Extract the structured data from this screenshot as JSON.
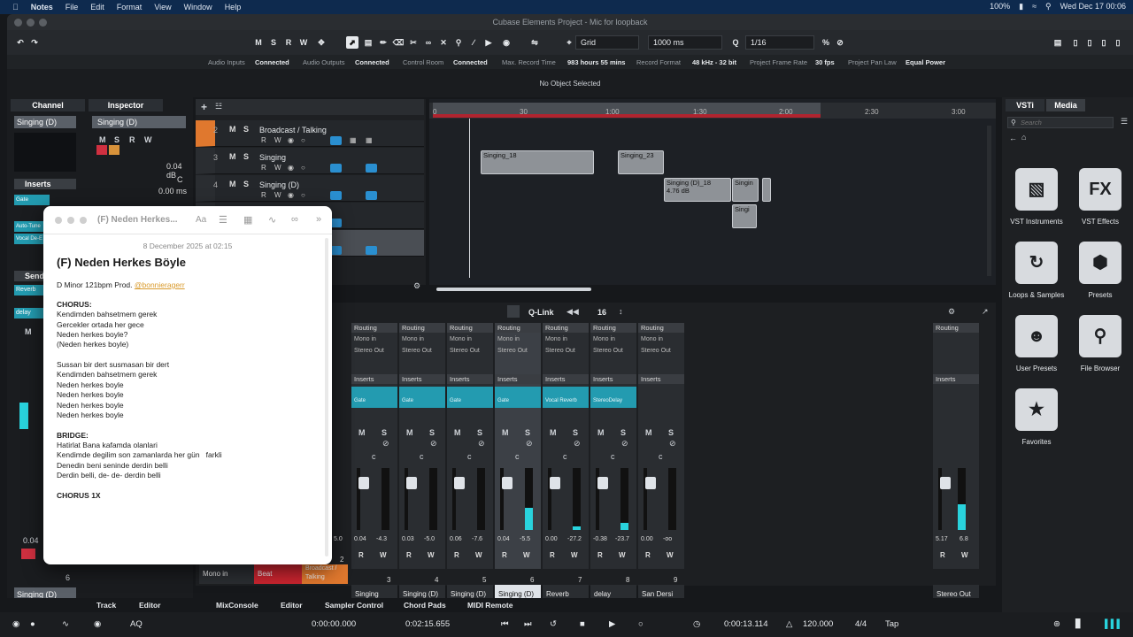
{
  "menubar": {
    "app": "Notes",
    "items": [
      "File",
      "Edit",
      "Format",
      "View",
      "Window",
      "Help"
    ],
    "battery": "100%",
    "clock": "Wed Dec 17  00:06"
  },
  "window": {
    "title": "Cubase Elements Project - Mic for loopback"
  },
  "toolbar": {
    "mode_buttons": [
      "M",
      "S",
      "R",
      "W"
    ],
    "snap": "Grid",
    "snap_value": "1000 ms",
    "quantize": "1/16"
  },
  "status": {
    "audio_inputs": "Audio Inputs",
    "audio_inputs_v": "Connected",
    "audio_outputs": "Audio Outputs",
    "audio_outputs_v": "Connected",
    "control_room": "Control Room",
    "control_room_v": "Connected",
    "max_rec": "Max. Record Time",
    "max_rec_v": "983 hours 55 mins",
    "rec_fmt": "Record Format",
    "rec_fmt_v": "48 kHz - 32 bit",
    "frame_rate": "Project Frame Rate",
    "frame_rate_v": "30 fps",
    "pan_law": "Project Pan Law",
    "pan_law_v": "Equal Power"
  },
  "info": {
    "text": "No Object Selected"
  },
  "left": {
    "tab_channel": "Channel",
    "tab_inspector": "Inspector",
    "channel_name": "Singing (D)",
    "inspector_name": "Singing (D)",
    "inserts": "Inserts",
    "sends": "Sends",
    "gate": "Gate",
    "auto_tune": "Auto-Tune",
    "vocal": "Vocal De-E",
    "reverb": "Reverb",
    "delay": "delay",
    "vol": "0.04 dB",
    "pan": "C",
    "delay_ms": "0.00 ms",
    "fader_val": "0.04",
    "ch_num": "6",
    "m_btn": "M"
  },
  "tracks": [
    {
      "num": "2",
      "name": "Broadcast / Talking"
    },
    {
      "num": "3",
      "name": "Singing"
    },
    {
      "num": "4",
      "name": "Singing (D)"
    },
    {
      "num": "",
      "name": ""
    },
    {
      "num": "",
      "name": ""
    }
  ],
  "ruler": {
    "ticks": [
      "0",
      "30",
      "1:00",
      "1:30",
      "2:00",
      "2:30",
      "3:00"
    ]
  },
  "clips": {
    "c1": "Singing_18",
    "c2": "Singing_23",
    "c3": "Singing (D)_18",
    "c3b": "4.76 dB",
    "c4": "Singin",
    "c5": "Singi"
  },
  "mixer": {
    "qlink": "Q-Link",
    "visible": "16",
    "routing": "Routing",
    "mono_in": "Mono in",
    "stereo_out": "Stereo Out",
    "inserts": "Inserts",
    "strips": [
      {
        "plug": "Gate",
        "db1": "0.04",
        "db2": "-4.3",
        "num": "3",
        "name": "Singing",
        "fill": 0.0
      },
      {
        "plug": "Gate",
        "db1": "0.03",
        "db2": "-5.0",
        "num": "4",
        "name": "Singing (D)",
        "fill": 0.0
      },
      {
        "plug": "Gate",
        "db1": "0.06",
        "db2": "-7.6",
        "num": "5",
        "name": "Singing (D)",
        "fill": 0.0
      },
      {
        "plug": "Gate",
        "db1": "0.04",
        "db2": "-5.5",
        "num": "6",
        "name": "Singing (D)",
        "fill": 0.35
      },
      {
        "plug": "Vocal Reverb",
        "db1": "0.00",
        "db2": "-27.2",
        "num": "7",
        "name": "Reverb",
        "fill": 0.05
      },
      {
        "plug": "StereoDelay",
        "db1": "-0.38",
        "db2": "-23.7",
        "num": "8",
        "name": "delay",
        "fill": 0.12
      },
      {
        "plug": "",
        "db1": "0.00",
        "db2": "-oo",
        "num": "9",
        "name": "San Dersi",
        "fill": 0.0
      }
    ],
    "left_names": [
      "Mono in",
      "Beat",
      "Broadcast / Talking"
    ],
    "first_db": "5.0",
    "first_num": "2",
    "master": {
      "routing": "Routing",
      "inserts": "Inserts",
      "db1": "5.17",
      "db2": "6.8",
      "name": "Stereo Out",
      "fill": 0.42
    }
  },
  "bottom_tabs": {
    "track": "Track",
    "editor": "Editor",
    "mixconsole": "MixConsole",
    "editor2": "Editor",
    "sampler": "Sampler Control",
    "chord": "Chord Pads",
    "midi": "MIDI Remote"
  },
  "transport": {
    "aq": "AQ",
    "left_locator": "0:00:00.000",
    "right_locator": "0:02:15.655",
    "position": "0:00:13.114",
    "tempo": "120.000",
    "signature": "4/4",
    "tap": "Tap"
  },
  "right": {
    "tab_vsti": "VSTi",
    "tab_media": "Media",
    "search_placeholder": "Search",
    "tiles": [
      "VST Instruments",
      "VST Effects",
      "Loops & Samples",
      "Presets",
      "User Presets",
      "File Browser",
      "Favorites"
    ]
  },
  "notes": {
    "toolbar_title": "(F) Neden Herkes...",
    "date": "8 December 2025 at 02:15",
    "title": "(F) Neden Herkes Böyle",
    "meta": "D Minor 121bpm Prod. ",
    "handle": "@bonnieragerr",
    "lines": [
      "CHORUS:",
      "Kendimden bahsetmem gerek",
      "Gercekler ortada her gece",
      "Neden herkes boyle?",
      "(Neden herkes boyle)",
      "",
      "Sussan bir dert susmasan bir dert",
      "Kendimden bahsetmem gerek",
      "Neden herkes boyle",
      "Neden herkes boyle",
      "Neden herkes boyle",
      "Neden herkes boyle",
      "",
      "BRIDGE:",
      "Hatirlat Bana kafamda olanlari",
      "Kendimde degilim son zamanlarda her gün   farkli",
      "Denedin beni seninde derdin belli",
      "Derdin belli, de- de- derdin belli",
      "",
      "CHORUS 1X"
    ]
  }
}
